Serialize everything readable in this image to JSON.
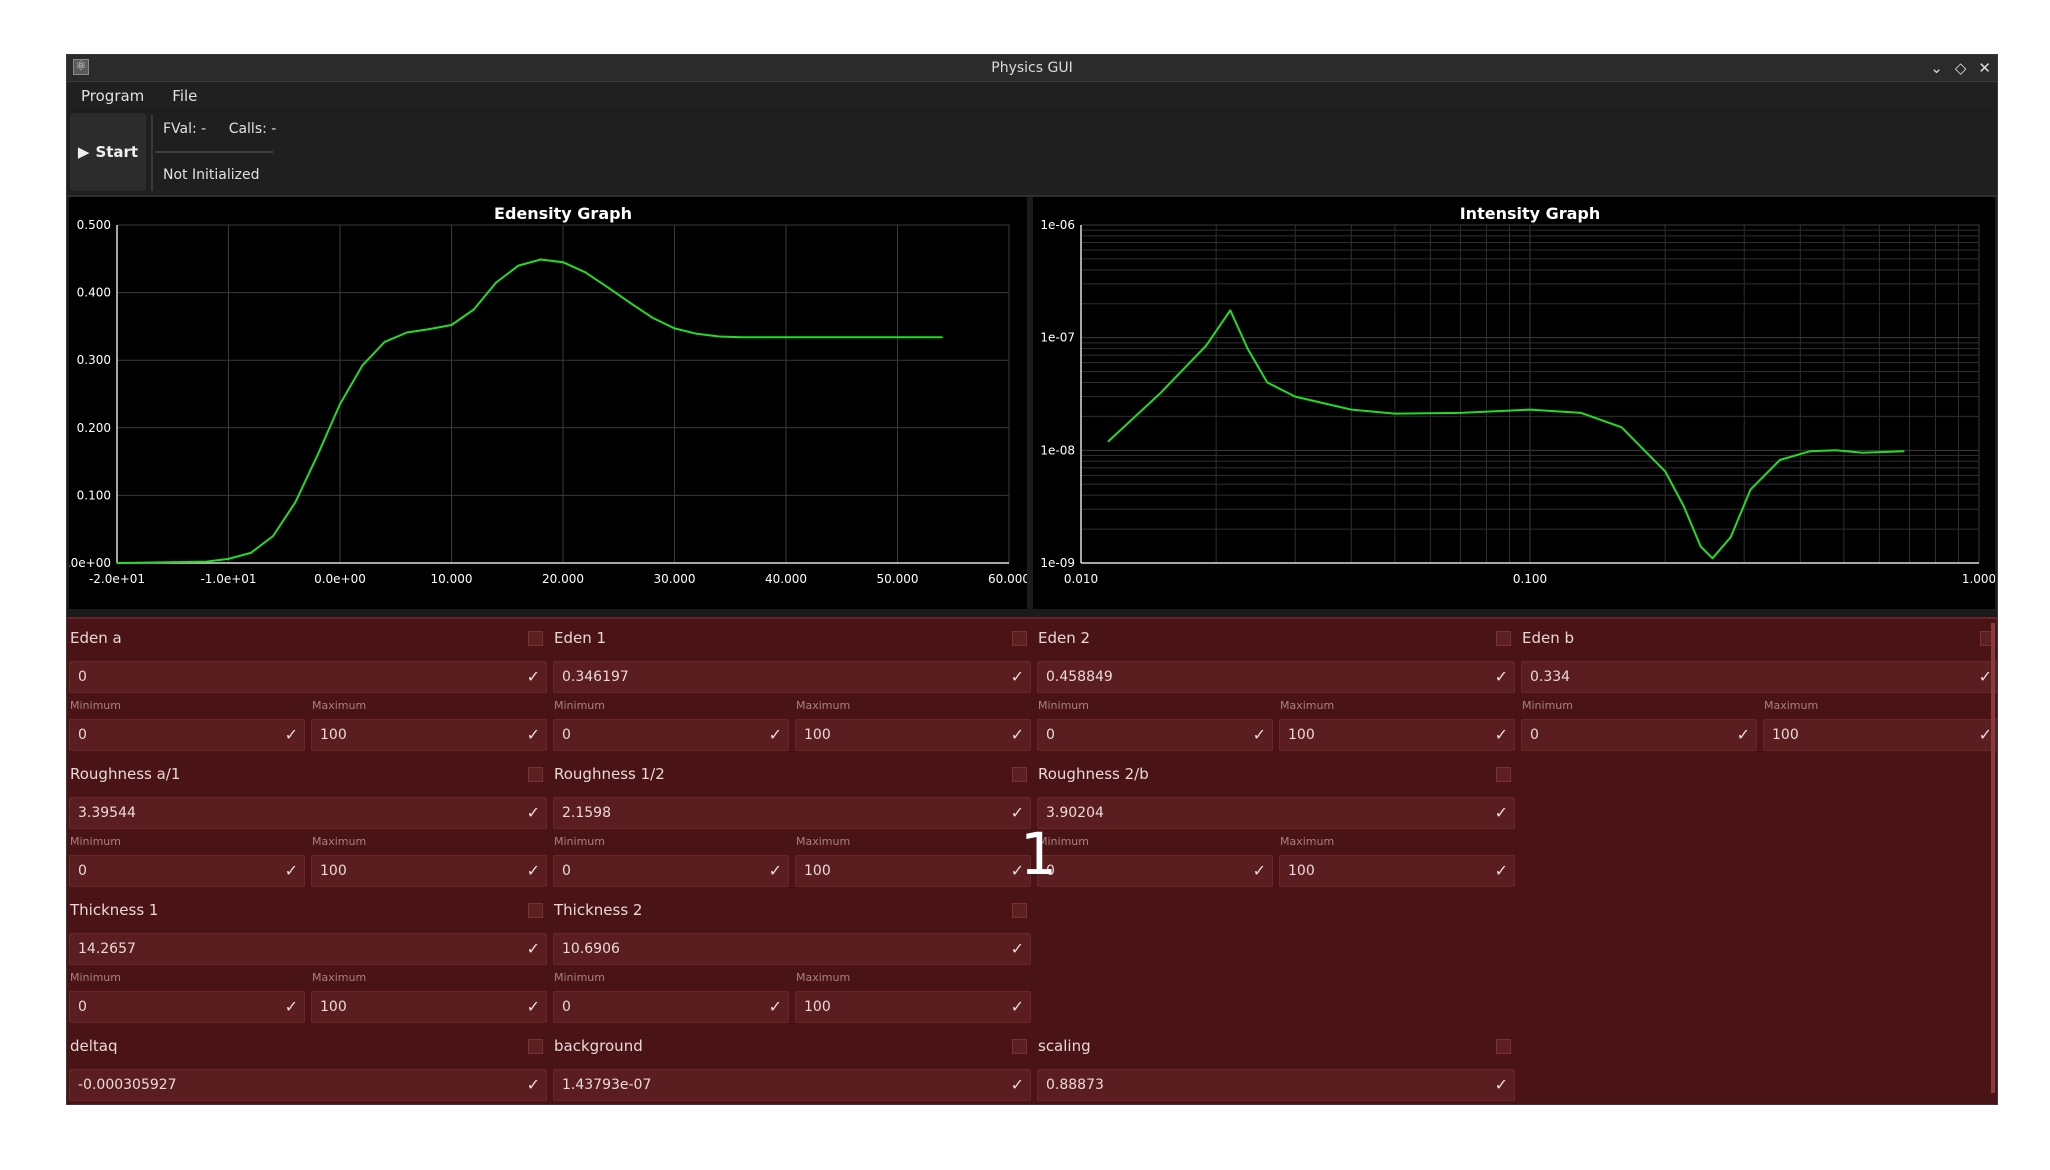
{
  "window": {
    "title": "Physics GUI",
    "controls": [
      "⌄",
      "◇",
      "✕"
    ]
  },
  "menu": {
    "items": [
      "Program",
      "File"
    ]
  },
  "toolbar": {
    "start_label": "Start",
    "fval": "FVal: -",
    "calls": "Calls: -",
    "status": "Not Initialized"
  },
  "overlay_label": "1",
  "graphs": [
    {
      "title": "Edensity Graph",
      "x_ticks": [
        "-2.0e+01",
        "-1.0e+01",
        "0.0e+00",
        "10.000",
        "20.000",
        "30.000",
        "40.000",
        "50.000",
        "60.000"
      ],
      "y_ticks": [
        "0.0e+00",
        "0.100",
        "0.200",
        "0.300",
        "0.400",
        "0.500"
      ]
    },
    {
      "title": "Intensity Graph",
      "x_ticks": [
        "0.010",
        "0.100",
        "1.000"
      ],
      "y_ticks": [
        "1e-09",
        "1e-08",
        "1e-07",
        "1e-06"
      ]
    }
  ],
  "params": [
    {
      "label": "Eden a",
      "value": "0",
      "min_label": "Minimum",
      "max_label": "Maximum",
      "min": "0",
      "max": "100"
    },
    {
      "label": "Eden 1",
      "value": "0.346197",
      "min_label": "Minimum",
      "max_label": "Maximum",
      "min": "0",
      "max": "100"
    },
    {
      "label": "Eden 2",
      "value": "0.458849",
      "min_label": "Minimum",
      "max_label": "Maximum",
      "min": "0",
      "max": "100"
    },
    {
      "label": "Eden b",
      "value": "0.334",
      "min_label": "Minimum",
      "max_label": "Maximum",
      "min": "0",
      "max": "100"
    },
    {
      "label": "Roughness a/1",
      "value": "3.39544",
      "min_label": "Minimum",
      "max_label": "Maximum",
      "min": "0",
      "max": "100"
    },
    {
      "label": "Roughness 1/2",
      "value": "2.1598",
      "min_label": "Minimum",
      "max_label": "Maximum",
      "min": "0",
      "max": "100"
    },
    {
      "label": "Roughness 2/b",
      "value": "3.90204",
      "min_label": "Minimum",
      "max_label": "Maximum",
      "min": "0",
      "max": "100"
    },
    {
      "label": "Thickness 1",
      "value": "14.2657",
      "min_label": "Minimum",
      "max_label": "Maximum",
      "min": "0",
      "max": "100"
    },
    {
      "label": "Thickness 2",
      "value": "10.6906",
      "min_label": "Minimum",
      "max_label": "Maximum",
      "min": "0",
      "max": "100"
    },
    {
      "label": "deltaq",
      "value": "-0.000305927"
    },
    {
      "label": "background",
      "value": "1.43793e-07"
    },
    {
      "label": "scaling",
      "value": "0.88873"
    }
  ],
  "chart_data": [
    {
      "type": "line",
      "title": "Edensity Graph",
      "xlabel": "",
      "ylabel": "",
      "xlim": [
        -20,
        60
      ],
      "ylim": [
        0,
        0.5
      ],
      "grid": true,
      "color": "#22dd22",
      "x": [
        -20,
        -12,
        -10,
        -8,
        -6,
        -4,
        -2,
        0,
        2,
        4,
        6,
        8,
        10,
        12,
        14,
        16,
        18,
        20,
        22,
        24,
        26,
        28,
        30,
        32,
        34,
        36,
        40,
        45,
        50,
        54
      ],
      "y": [
        0,
        0.002,
        0.006,
        0.015,
        0.04,
        0.09,
        0.16,
        0.235,
        0.292,
        0.327,
        0.341,
        0.346,
        0.352,
        0.375,
        0.415,
        0.44,
        0.449,
        0.445,
        0.43,
        0.408,
        0.385,
        0.363,
        0.347,
        0.339,
        0.335,
        0.334,
        0.334,
        0.334,
        0.334,
        0.334
      ]
    },
    {
      "type": "line",
      "title": "Intensity Graph",
      "xlabel": "",
      "ylabel": "",
      "xlim": [
        0.01,
        1.0
      ],
      "ylim": [
        1e-09,
        1e-06
      ],
      "x_scale": "log",
      "y_scale": "log",
      "grid": true,
      "color": "#22dd22",
      "x": [
        0.0115,
        0.015,
        0.019,
        0.0215,
        0.0235,
        0.026,
        0.03,
        0.04,
        0.05,
        0.07,
        0.1,
        0.13,
        0.16,
        0.2,
        0.22,
        0.24,
        0.255,
        0.28,
        0.31,
        0.36,
        0.42,
        0.48,
        0.55,
        0.68
      ],
      "y": [
        1.2e-08,
        3.2e-08,
        8.5e-08,
        1.75e-07,
        8e-08,
        4e-08,
        3e-08,
        2.3e-08,
        2.12e-08,
        2.15e-08,
        2.3e-08,
        2.15e-08,
        1.6e-08,
        6.5e-09,
        3.2e-09,
        1.4e-09,
        1.1e-09,
        1.7e-09,
        4.5e-09,
        8.2e-09,
        9.8e-09,
        1e-08,
        9.5e-09,
        9.8e-09
      ]
    }
  ]
}
